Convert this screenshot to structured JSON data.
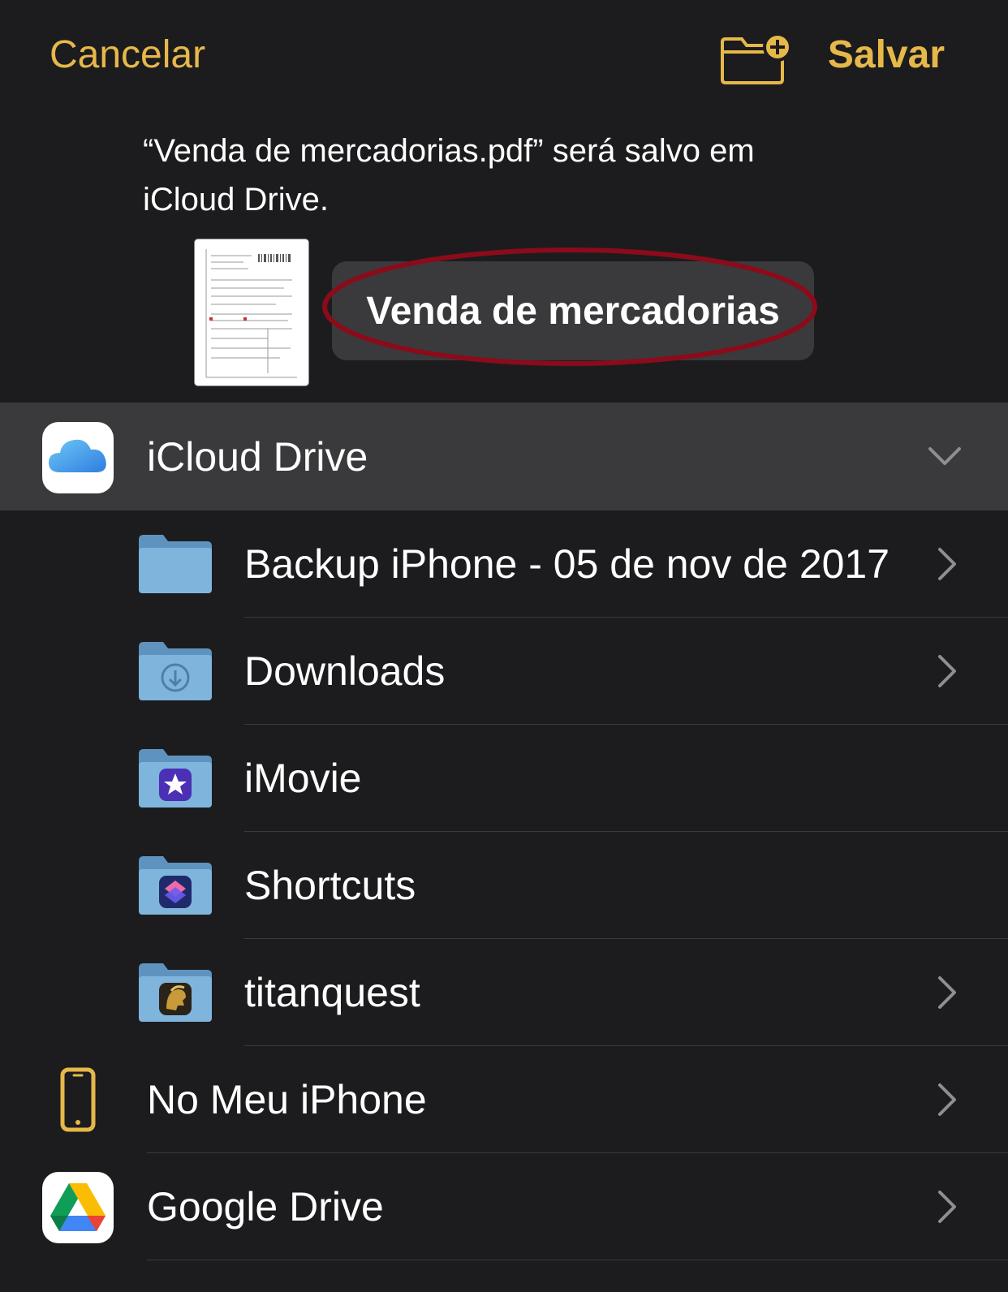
{
  "nav": {
    "cancel_label": "Cancelar",
    "save_label": "Salvar",
    "new_folder_icon": "folder-badge-plus-icon"
  },
  "message": {
    "line1": "“Venda de mercadorias.pdf” será salvo em",
    "line2": "iCloud Drive."
  },
  "file": {
    "thumbnail_icon": "pdf-document-thumbnail",
    "name_value": "Venda de mercadorias"
  },
  "locations": {
    "icloud": {
      "label": "iCloud Drive",
      "icon": "icloud-icon",
      "expanded": true
    },
    "folders": [
      {
        "label": "Backup iPhone - 05 de nov de 2017",
        "icon": "folder-icon",
        "chevron": true
      },
      {
        "label": "Downloads",
        "icon": "downloads-folder-icon",
        "chevron": true
      },
      {
        "label": "iMovie",
        "icon": "imovie-folder-icon",
        "chevron": false
      },
      {
        "label": "Shortcuts",
        "icon": "shortcuts-folder-icon",
        "chevron": false
      },
      {
        "label": "titanquest",
        "icon": "titanquest-folder-icon",
        "chevron": true
      }
    ],
    "on_my_iphone": {
      "label": "No Meu iPhone",
      "icon": "iphone-icon"
    },
    "google_drive": {
      "label": "Google Drive",
      "icon": "google-drive-icon"
    }
  },
  "colors": {
    "accent": "#e6b84a",
    "background": "#1c1c1e",
    "selected_row": "#3a3a3c",
    "highlight_ring": "#8b0b1a",
    "folder_blue": "#7fb4dd"
  }
}
